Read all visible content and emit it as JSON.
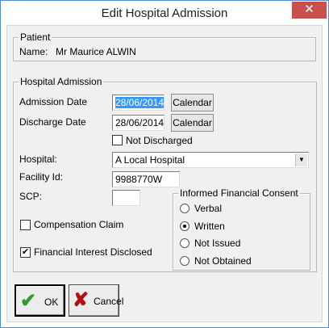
{
  "window": {
    "title": "Edit Hospital Admission",
    "close_glyph": "✕"
  },
  "patient": {
    "group_label": "Patient",
    "name_label": "Name:",
    "name_value": "Mr Maurice ALWIN"
  },
  "admission": {
    "group_label": "Hospital Admission",
    "admission_date_label": "Admission Date",
    "admission_date_value": "28/06/2014",
    "discharge_date_label": "Discharge Date",
    "discharge_date_value": "28/06/2014",
    "calendar_label": "Calendar",
    "not_discharged_label": "Not Discharged",
    "not_discharged_checked": false,
    "hospital_label": "Hospital:",
    "hospital_value": "A Local Hospital",
    "facility_label": "Facility Id:",
    "facility_value": "9988770W",
    "scp_label": "SCP:",
    "scp_value": "",
    "compensation_label": "Compensation Claim",
    "compensation_checked": false,
    "financial_interest_label": "Financial Interest Disclosed",
    "financial_interest_checked": true,
    "check_glyph": "✔"
  },
  "consent": {
    "group_label": "Informed Financial Consent",
    "options": [
      {
        "label": "Verbal",
        "selected": false
      },
      {
        "label": "Written",
        "selected": true
      },
      {
        "label": "Not Issued",
        "selected": false
      },
      {
        "label": "Not Obtained",
        "selected": false
      }
    ]
  },
  "buttons": {
    "ok_label": "OK",
    "ok_glyph": "✔",
    "ok_color": "#2e9e2e",
    "cancel_label": "Cancel",
    "cancel_glyph": "✘",
    "cancel_color": "#b01010"
  }
}
